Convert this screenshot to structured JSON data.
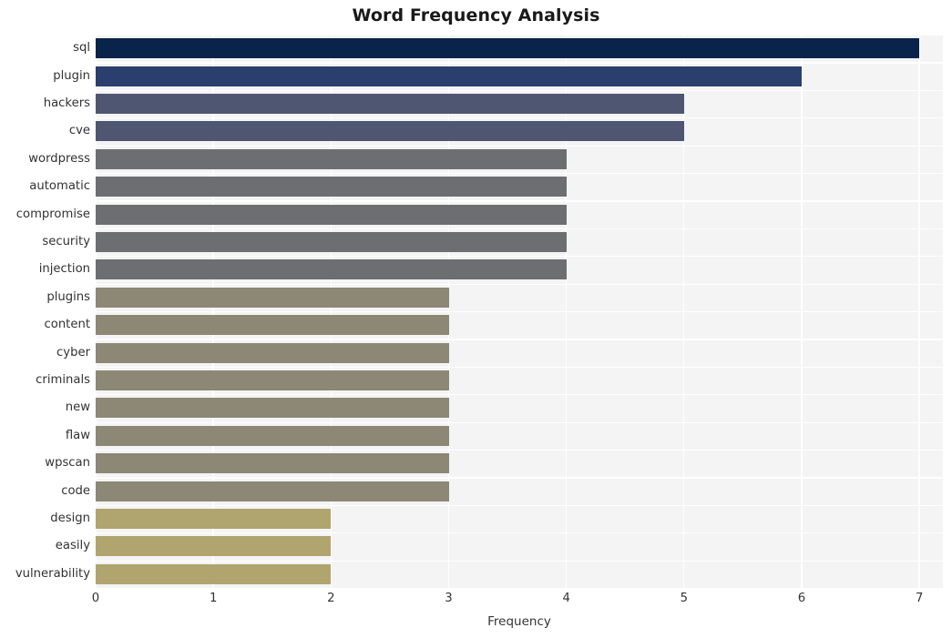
{
  "chart_data": {
    "type": "bar",
    "orientation": "horizontal",
    "title": "Word Frequency Analysis",
    "xlabel": "Frequency",
    "ylabel": "",
    "xlim": [
      0,
      7.2
    ],
    "xticks": [
      0,
      1,
      2,
      3,
      4,
      5,
      6,
      7
    ],
    "xtick_labels": [
      "0",
      "1",
      "2",
      "3",
      "4",
      "5",
      "6",
      "7"
    ],
    "grid": true,
    "grid_color": "#ffffff",
    "plot_background": "#f4f4f5",
    "figure_background": "#ffffff",
    "legend": null,
    "categories": [
      "sql",
      "plugin",
      "hackers",
      "cve",
      "wordpress",
      "automatic",
      "compromise",
      "security",
      "injection",
      "plugins",
      "content",
      "cyber",
      "criminals",
      "new",
      "flaw",
      "wpscan",
      "code",
      "design",
      "easily",
      "vulnerability"
    ],
    "values": [
      7,
      6,
      5,
      5,
      4,
      4,
      4,
      4,
      4,
      3,
      3,
      3,
      3,
      3,
      3,
      3,
      3,
      2,
      2,
      2
    ],
    "bar_colors": [
      "#09234b",
      "#2a3f6e",
      "#4f5671",
      "#4f5671",
      "#6c6e72",
      "#6c6e72",
      "#6c6e72",
      "#6c6e72",
      "#6c6e72",
      "#8d8875",
      "#8d8875",
      "#8d8875",
      "#8d8875",
      "#8d8875",
      "#8d8875",
      "#8d8875",
      "#8d8875",
      "#b0a56f",
      "#b0a56f",
      "#b0a56f"
    ]
  }
}
